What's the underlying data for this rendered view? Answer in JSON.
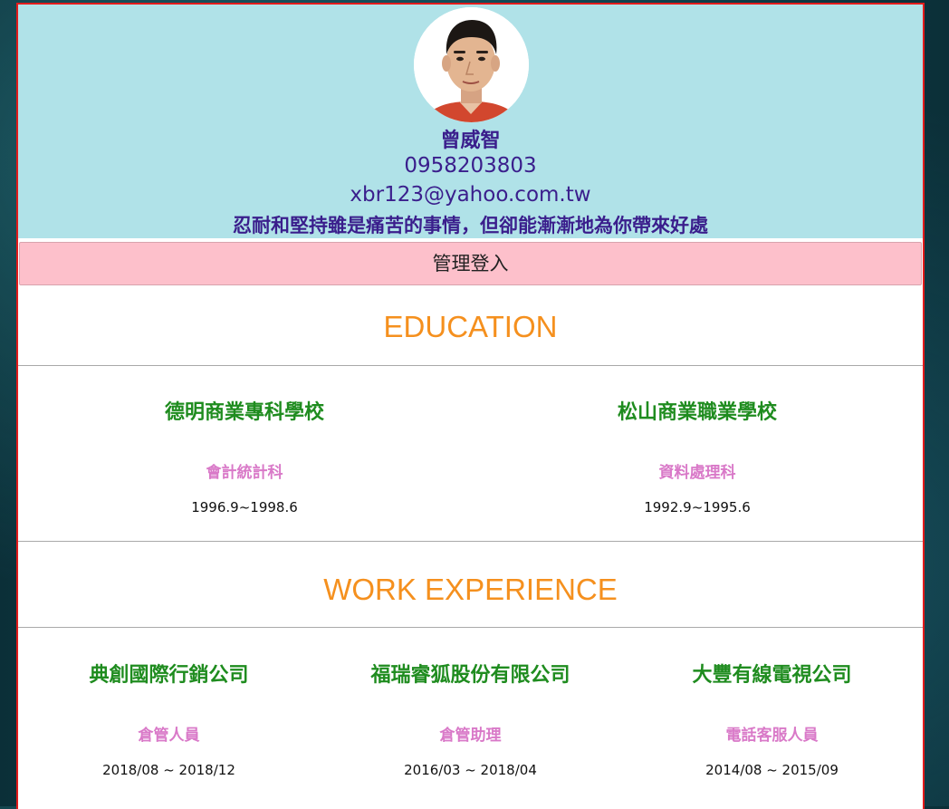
{
  "profile": {
    "name": "曾威智",
    "phone": "0958203803",
    "email": "xbr123@yahoo.com.tw",
    "motto": "忍耐和堅持雖是痛苦的事情，但卻能漸漸地為你帶來好處"
  },
  "admin_login_label": "管理登入",
  "education": {
    "title": "EDUCATION",
    "items": [
      {
        "school": "德明商業專科學校",
        "department": "會計統計科",
        "period": "1996.9~1998.6"
      },
      {
        "school": "松山商業職業學校",
        "department": "資料處理科",
        "period": "1992.9~1995.6"
      }
    ]
  },
  "work": {
    "title": "WORK EXPERIENCE",
    "items": [
      {
        "company": "典創國際行銷公司",
        "position": "倉管人員",
        "period": "2018/08 ~ 2018/12"
      },
      {
        "company": "福瑞睿狐股份有限公司",
        "position": "倉管助理",
        "period": "2016/03 ~ 2018/04"
      },
      {
        "company": "大豐有線電視公司",
        "position": "電話客服人員",
        "period": "2014/08 ~ 2015/09"
      }
    ]
  },
  "colors": {
    "header_bg": "#b0e2e8",
    "header_text": "#3a1e8c",
    "admin_bar_bg": "#fdc0cb",
    "section_title": "#f5901e",
    "org_name": "#1f8c1f",
    "role": "#d979c8",
    "frame_border": "#e31b1b"
  }
}
